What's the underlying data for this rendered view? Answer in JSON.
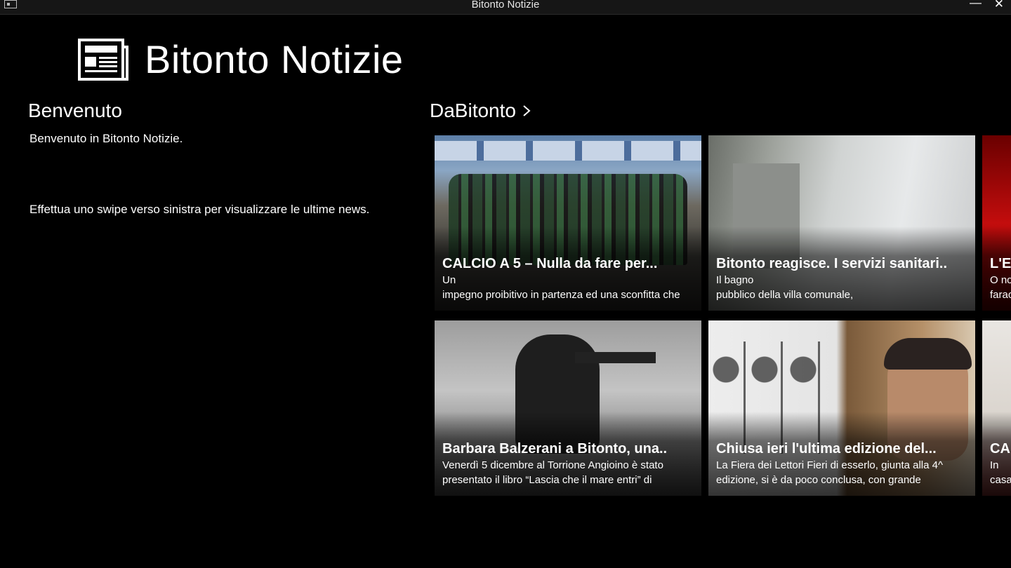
{
  "window": {
    "title": "Bitonto Notizie",
    "minimize_glyph": "—",
    "close_glyph": "✕"
  },
  "header": {
    "title": "Bitonto Notizie",
    "logo_icon": "newspaper-icon"
  },
  "welcome": {
    "title": "Benvenuto",
    "line1": "Benvenuto in Bitonto Notizie.",
    "line2": "Effettua uno swipe verso sinistra per visualizzare le ultime news."
  },
  "group": {
    "title": "DaBitonto",
    "chevron_icon": "chevron-right-icon"
  },
  "tiles": [
    {
      "title": "CALCIO A 5 – Nulla da fare per...",
      "line1": "Un",
      "line2": "impegno proibitivo in partenza ed una sconfitta che"
    },
    {
      "title": "Bitonto reagisce. I servizi sanitari..",
      "line1": "Il bagno",
      "line2": "pubblico della villa comunale,"
    },
    {
      "title": "L'El",
      "line1": "O no",
      "line2": "farao"
    },
    {
      "title": "Barbara Balzerani a Bitonto, una..",
      "line1": "Venerdì 5 dicembre al Torrione Angioino è stato",
      "line2": "presentato il libro “Lascia che il mare entri” di"
    },
    {
      "title": "Chiusa ieri l'ultima edizione del...",
      "line1": "La Fiera dei Lettori Fieri di esserlo, giunta alla 4^",
      "line2": "edizione, si è da poco conclusa, con grande"
    },
    {
      "title": "CAL",
      "line1": "In",
      "line2": "casa"
    }
  ]
}
